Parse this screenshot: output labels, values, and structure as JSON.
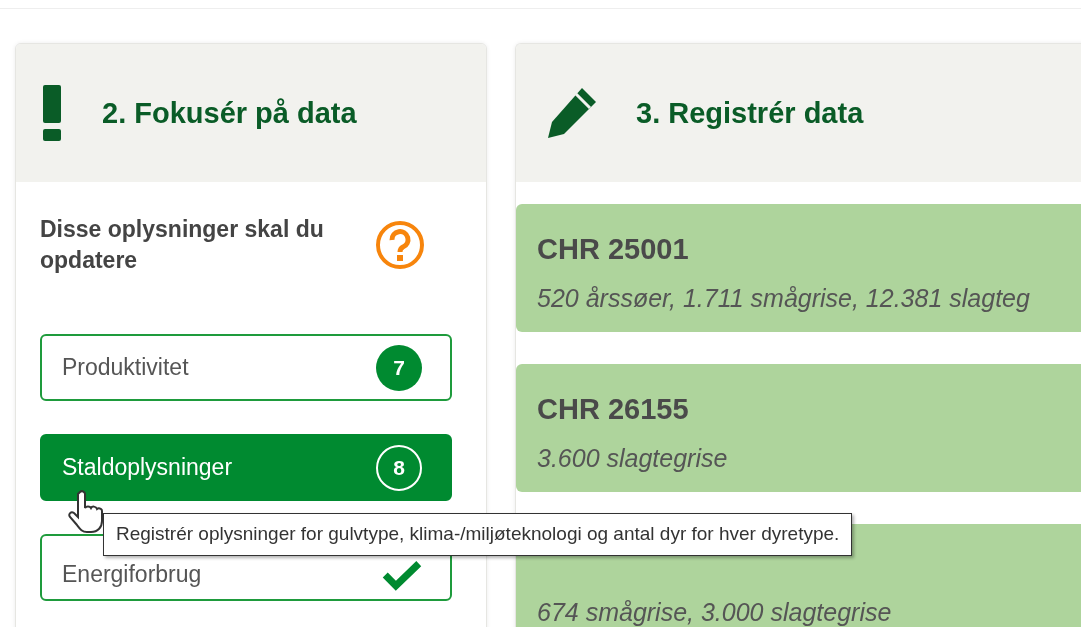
{
  "focus_panel": {
    "title": "2. Fokusér på data",
    "intro": "Disse oplysninger skal du opdatere",
    "items": [
      {
        "label": "Produktivitet",
        "kind": "count",
        "count": "7",
        "selected": false
      },
      {
        "label": "Staldoplysninger",
        "kind": "count",
        "count": "8",
        "selected": true
      },
      {
        "label": "Energiforbrug",
        "kind": "done",
        "selected": false
      }
    ]
  },
  "register_panel": {
    "title": "3. Registrér data",
    "herds": [
      {
        "title": "CHR 25001",
        "summary": "520 årssøer, 1.711 smågrise, 12.381 slagteg"
      },
      {
        "title": "CHR 26155",
        "summary": "3.600 slagtegrise"
      },
      {
        "summary": "674 smågrise, 3.000 slagtegrise"
      }
    ]
  },
  "tooltip": "Registrér oplysninger for gulvtype, klima-/miljøteknologi og antal dyr for hver dyretype."
}
